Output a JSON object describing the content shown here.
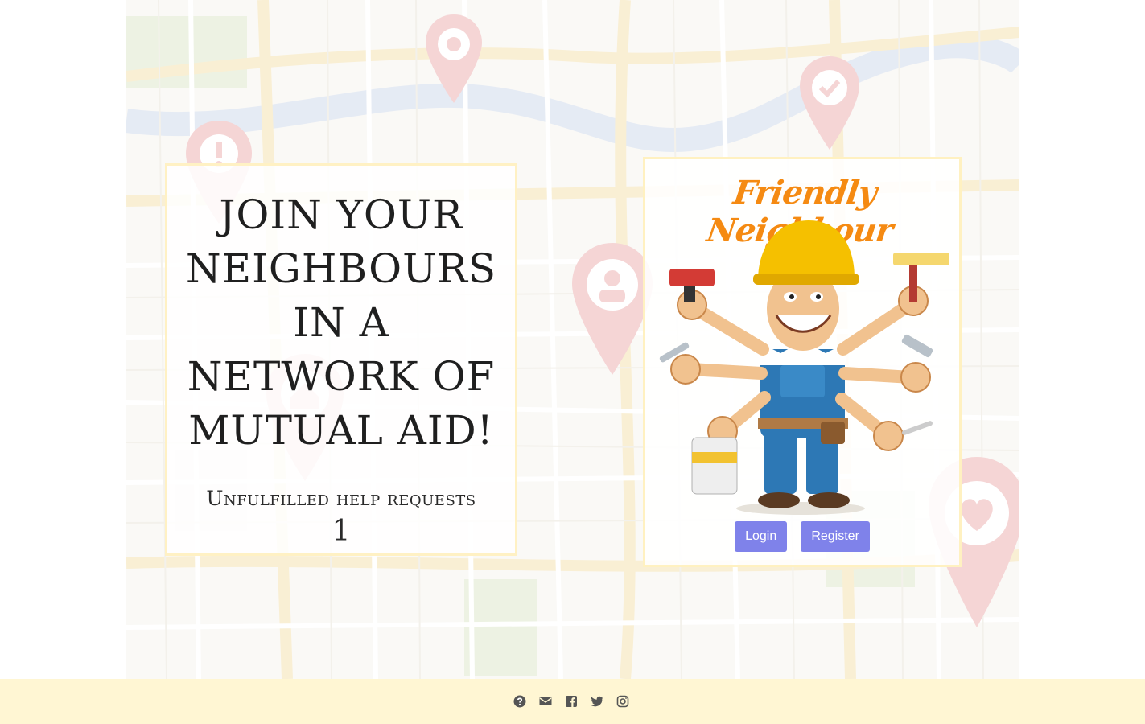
{
  "hero": {
    "headline": "JOIN YOUR NEIGHBOURS IN A NETWORK OF MUTUAL AID!",
    "stats_label": "Unfulfilled help requests",
    "stats_count": "1"
  },
  "brand": {
    "name": "Friendly Neighbour",
    "mascot_icon": "handyman-mascot-illustration"
  },
  "auth": {
    "login_label": "Login",
    "register_label": "Register"
  },
  "footer": {
    "icons": [
      "question-circle-icon",
      "envelope-icon",
      "facebook-icon",
      "twitter-icon",
      "instagram-icon"
    ]
  },
  "colors": {
    "button": "#7f82ea",
    "brand_orange": "#f58a12",
    "footer_bg": "#fff6d3",
    "card_border": "#fff0be",
    "pin_red": "#e07b7b"
  }
}
